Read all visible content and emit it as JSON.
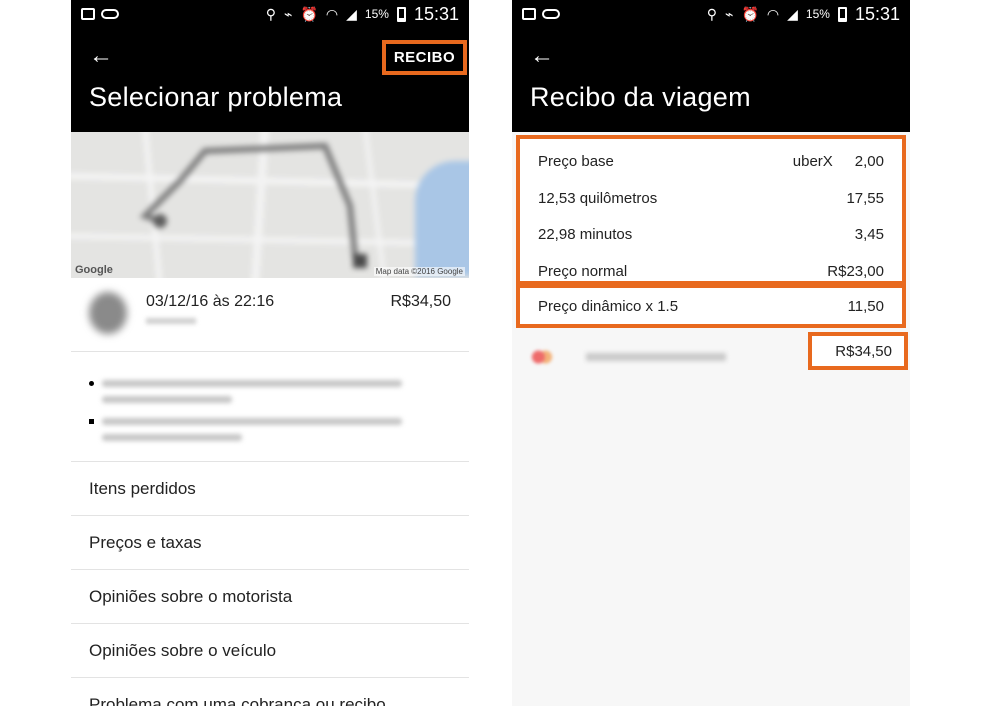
{
  "status_bar": {
    "battery_percent": "15%",
    "time": "15:31"
  },
  "left": {
    "back_icon": "arrow-left",
    "recibo_button": "RECIBO",
    "title": "Selecionar problema",
    "map": {
      "google_logo": "Google",
      "credit": "Map data ©2016 Google"
    },
    "trip": {
      "date": "03/12/16 às 22:16",
      "price": "R$34,50"
    },
    "menu_items": [
      "Itens perdidos",
      "Preços e taxas",
      "Opiniões sobre o motorista",
      "Opiniões sobre o veículo",
      "Problema com uma cobrança ou recibo"
    ]
  },
  "right": {
    "back_icon": "arrow-left",
    "title": "Recibo da viagem",
    "fare_rows": [
      {
        "label": "Preço base",
        "product": "uberX",
        "value": "2,00"
      },
      {
        "label": "12,53 quilômetros",
        "value": "17,55"
      },
      {
        "label": "22,98 minutos",
        "value": "3,45"
      },
      {
        "label": "Preço normal",
        "value": "R$23,00"
      }
    ],
    "surge": {
      "label": "Preço dinâmico x 1.5",
      "value": "11,50"
    },
    "total": "R$34,50"
  },
  "colors": {
    "highlight": "#e8691e",
    "appbar": "#000000",
    "water": "#a9c6e6"
  }
}
